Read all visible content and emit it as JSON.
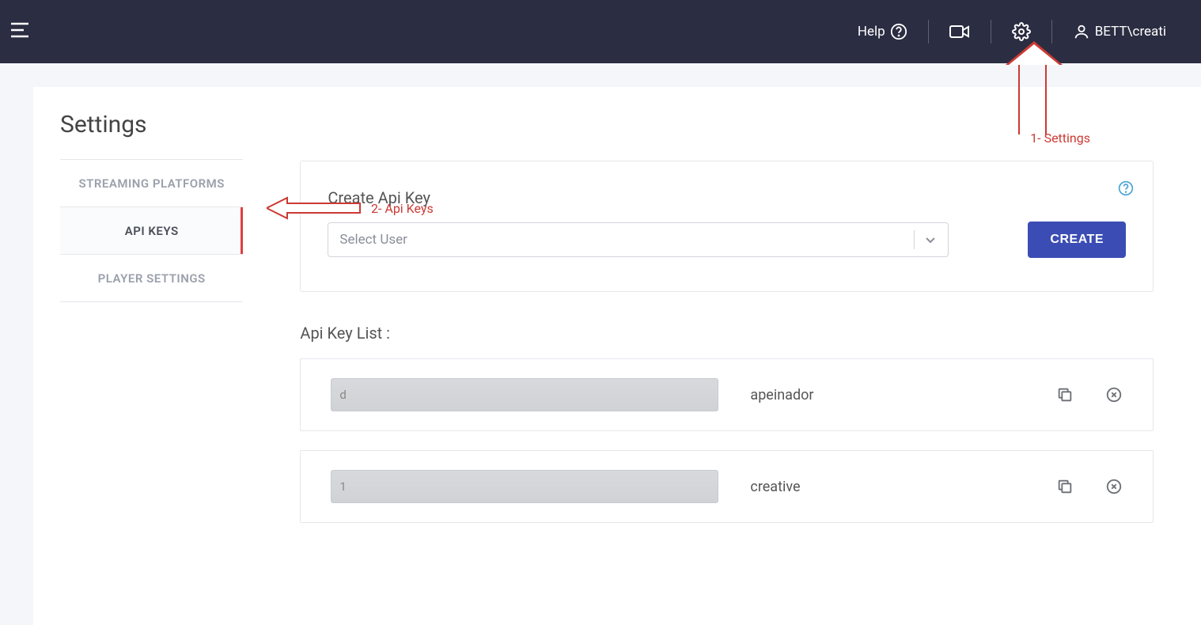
{
  "header": {
    "help_label": "Help",
    "username": "BETT\\creati"
  },
  "page": {
    "title": "Settings"
  },
  "tabs": {
    "items": [
      {
        "label": "STREAMING PLATFORMS"
      },
      {
        "label": "API KEYS"
      },
      {
        "label": "PLAYER SETTINGS"
      }
    ]
  },
  "panel": {
    "title": "Create Api Key",
    "select_placeholder": "Select User",
    "create_button": "CREATE"
  },
  "list": {
    "title": "Api Key List :",
    "items": [
      {
        "key_prefix": "d",
        "user": "apeinador"
      },
      {
        "key_prefix": "1",
        "user": "creative"
      }
    ]
  },
  "annotations": {
    "a1": "1-   Settings",
    "a2": "2- Api Keys"
  }
}
